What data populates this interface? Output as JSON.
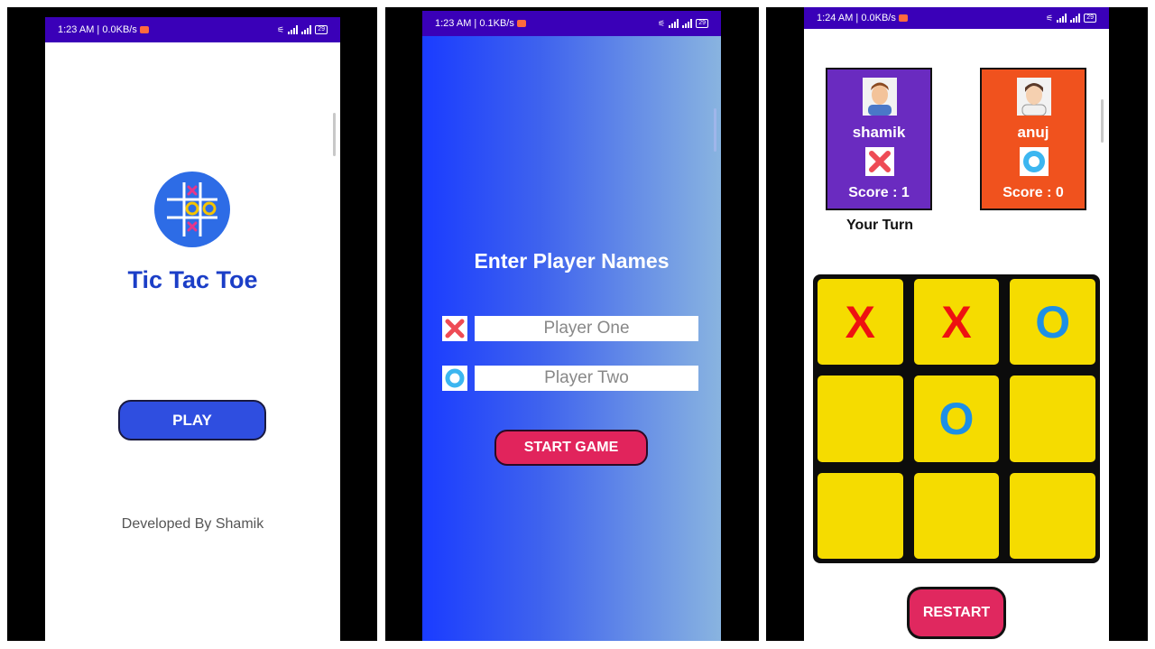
{
  "screen1": {
    "status": {
      "time": "1:23 AM | 0.0KB/s",
      "battery": "29"
    },
    "title": "Tic Tac Toe",
    "play_label": "PLAY",
    "developer": "Developed By Shamik"
  },
  "screen2": {
    "status": {
      "time": "1:23 AM | 0.1KB/s",
      "battery": "29"
    },
    "title": "Enter Player Names",
    "player_one_placeholder": "Player One",
    "player_two_placeholder": "Player Two",
    "start_label": "START GAME"
  },
  "screen3": {
    "status": {
      "time": "1:24 AM | 0.0KB/s",
      "battery": "29"
    },
    "player1": {
      "name": "shamik",
      "score": "Score : 1",
      "color": "#6a2bc0",
      "mark_icon": "x-mark-icon"
    },
    "player2": {
      "name": "anuj",
      "score": "Score : 0",
      "color": "#f0521e",
      "mark_icon": "o-mark-icon"
    },
    "turn": "Your Turn",
    "board": [
      "X",
      "X",
      "O",
      "",
      "O",
      "",
      "",
      "",
      ""
    ],
    "restart_label": "RESTART"
  },
  "colors": {
    "x": "#ee1111",
    "o": "#1d8fe6",
    "cell": "#f5dc00",
    "statusbar": "#3a00b8"
  }
}
